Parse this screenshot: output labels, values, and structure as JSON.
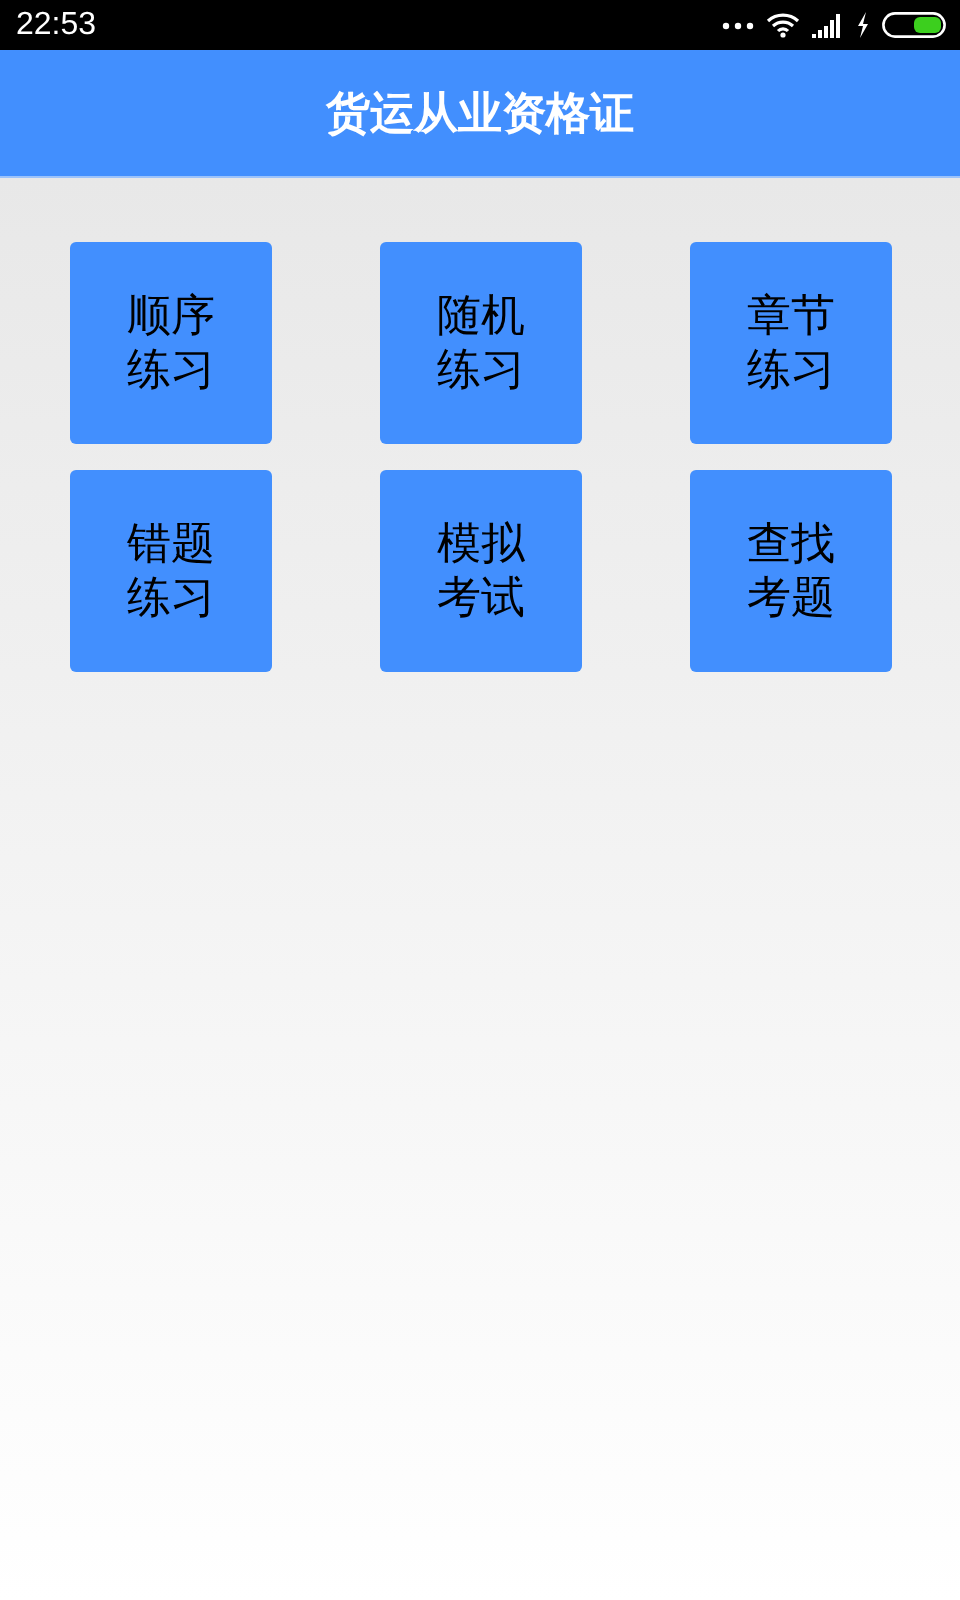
{
  "status_bar": {
    "time": "22:53"
  },
  "header": {
    "title": "货运从业资格证"
  },
  "menu": [
    {
      "label": "顺序练习"
    },
    {
      "label": "随机练习"
    },
    {
      "label": "章节练习"
    },
    {
      "label": "错题练习"
    },
    {
      "label": "模拟考试"
    },
    {
      "label": "查找考题"
    }
  ]
}
